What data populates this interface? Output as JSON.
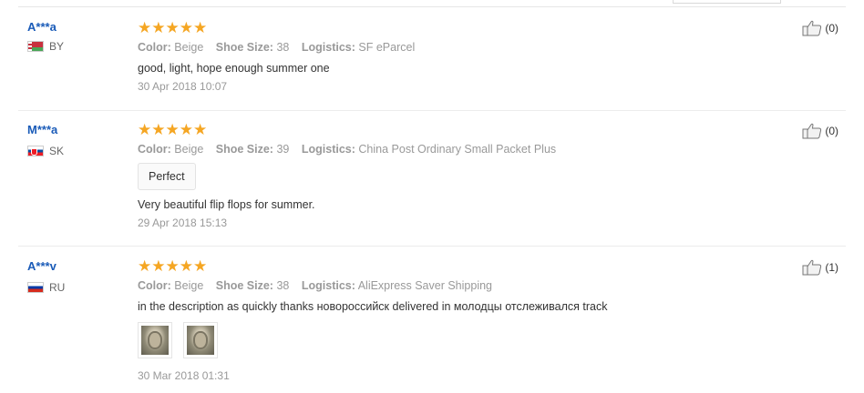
{
  "reviews": [
    {
      "user": "A***a",
      "country": "BY",
      "stars": "★★★★★",
      "color_label": "Color:",
      "color_value": "Beige",
      "size_label": "Shoe Size:",
      "size_value": "38",
      "logistics_label": "Logistics:",
      "logistics_value": "SF eParcel",
      "text": "good, light, hope enough summer one",
      "date": "30 Apr 2018 10:07",
      "likes": "(0)"
    },
    {
      "user": "M***a",
      "country": "SK",
      "stars": "★★★★★",
      "color_label": "Color:",
      "color_value": "Beige",
      "size_label": "Shoe Size:",
      "size_value": "39",
      "logistics_label": "Logistics:",
      "logistics_value": "China Post Ordinary Small Packet Plus",
      "tag": "Perfect",
      "text": "Very beautiful flip flops for summer.",
      "date": "29 Apr 2018 15:13",
      "likes": "(0)"
    },
    {
      "user": "A***v",
      "country": "RU",
      "stars": "★★★★★",
      "color_label": "Color:",
      "color_value": "Beige",
      "size_label": "Shoe Size:",
      "size_value": "38",
      "logistics_label": "Logistics:",
      "logistics_value": "AliExpress Saver Shipping",
      "text": "in the description as quickly thanks новороссийск delivered in молодцы отслеживался track",
      "date": "30 Mar 2018 01:31",
      "likes": "(1)"
    }
  ],
  "colors": {
    "star": "#f5a623",
    "username": "#1a5bb8",
    "muted": "#999999"
  },
  "icons": {
    "like": "thumbs-up-icon",
    "star": "star-icon"
  },
  "rating_value": 5,
  "rating_max": 5
}
